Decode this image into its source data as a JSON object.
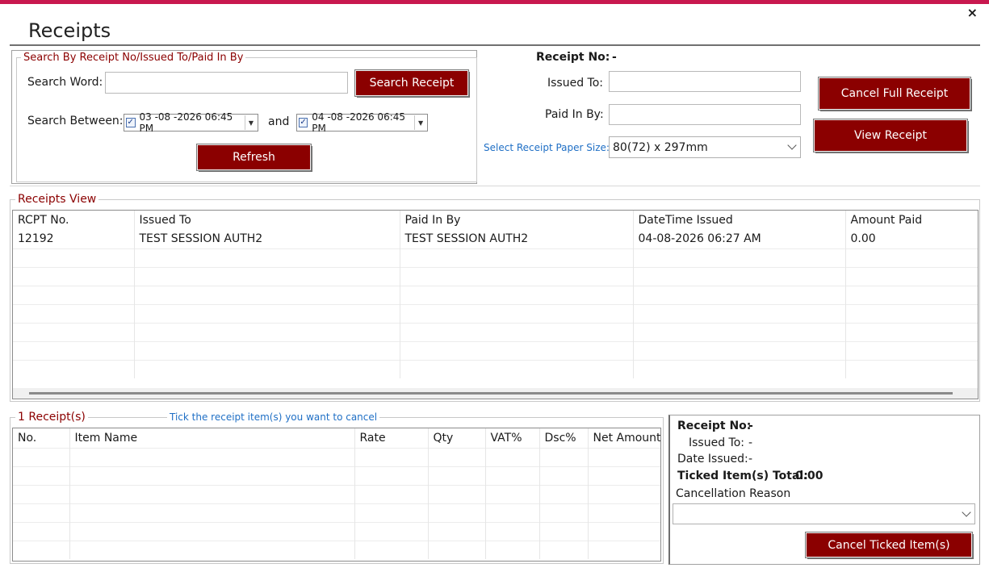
{
  "window": {
    "title": "Receipts",
    "close_glyph": "×"
  },
  "search": {
    "legend": "Search By Receipt No/Issued To/Paid In By",
    "word_label": "Search Word:",
    "word_value": "",
    "search_button": "Search Receipt",
    "between_label": "Search Between:",
    "from_date": "03 -08 -2026  06:45 PM",
    "from_checked": true,
    "and_label": "and",
    "to_date": "04 -08 -2026  06:45 PM",
    "to_checked": true,
    "refresh_button": "Refresh"
  },
  "receipt_info": {
    "receipt_no_label": "Receipt No:",
    "receipt_no_value": "-",
    "issued_to_label": "Issued To:",
    "issued_to_value": "",
    "paid_in_by_label": "Paid In By:",
    "paid_in_by_value": "",
    "paper_size_label": "Select Receipt Paper Size:",
    "paper_size_value": "80(72) x 297mm",
    "cancel_full_button": "Cancel Full Receipt",
    "view_button": "View Receipt"
  },
  "receipts_view": {
    "legend": "Receipts View",
    "columns": [
      "RCPT No.",
      "Issued To",
      "Paid In By",
      "DateTime Issued",
      "Amount Paid"
    ],
    "rows": [
      [
        "12192",
        "TEST SESSION AUTH2",
        "TEST SESSION AUTH2",
        "04-08-2026 06:27 AM",
        "0.00"
      ]
    ]
  },
  "items": {
    "count_label": "1 Receipt(s)",
    "hint": "Tick the receipt item(s) you want to cancel",
    "columns": [
      "No.",
      "Item Name",
      "Rate",
      "Qty",
      "VAT%",
      "Dsc%",
      "Net Amount"
    ],
    "rows": []
  },
  "cancel_panel": {
    "receipt_no_label": "Receipt No:",
    "receipt_no_value": "-",
    "issued_to_label": "Issued To:",
    "issued_to_value": "-",
    "date_issued_label": "Date Issued:",
    "date_issued_value": "-",
    "ticked_total_label": "Ticked Item(s) Total:",
    "ticked_total_value": "0.00",
    "reason_label": "Cancellation Reason",
    "reason_value": "",
    "cancel_ticked_button": "Cancel Ticked Item(s)"
  },
  "colors": {
    "accent_bar": "#c8184f",
    "button": "#8b0000",
    "legend_text": "#8b0000",
    "link_text": "#1f6fc5"
  }
}
